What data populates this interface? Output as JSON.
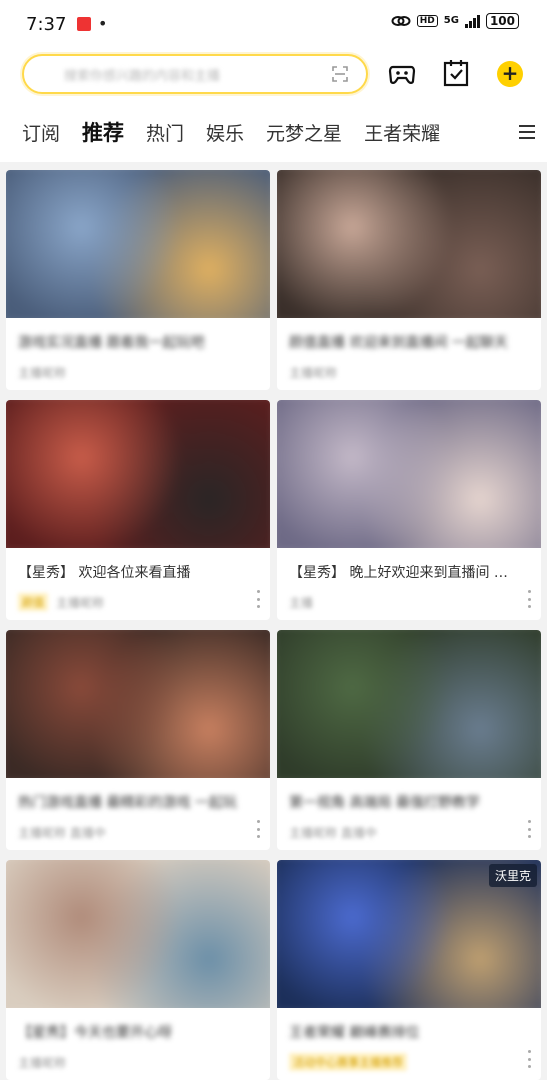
{
  "status_bar": {
    "time": "7:37",
    "dot": "•",
    "network": "5G",
    "hd": "HD",
    "battery": "100"
  },
  "search": {
    "placeholder": "搜索你感兴趣的内容和主播"
  },
  "tabs": [
    {
      "label": "订阅"
    },
    {
      "label": "推荐"
    },
    {
      "label": "热门"
    },
    {
      "label": "娱乐"
    },
    {
      "label": "元梦之星"
    },
    {
      "label": "王者荣耀"
    }
  ],
  "cards": [
    {
      "title": "游戏实况直播 跟着我一起玩吧",
      "tag": "",
      "sub": "主播昵称",
      "badge": "",
      "colors": [
        "#4a5d7a",
        "#8aa6c9",
        "#e0b060"
      ]
    },
    {
      "title": "颜值直播 欢迎来到直播间 一起聊天",
      "tag": "",
      "sub": "主播昵称",
      "badge": "",
      "colors": [
        "#3a2f2a",
        "#c9a898",
        "#7a5f55"
      ]
    },
    {
      "title": "【星秀】 欢迎各位来看直播",
      "tag": "颜值",
      "sub": "主播昵称",
      "badge": "",
      "colors": [
        "#5c1e1e",
        "#c95d4a",
        "#2a2626"
      ]
    },
    {
      "title": "【星秀】 晚上好欢迎来到直播间 …",
      "tag": "",
      "sub": "主播",
      "badge": "",
      "colors": [
        "#6e6a86",
        "#c4b9c8",
        "#e6d5cf"
      ]
    },
    {
      "title": "热门游戏直播 最精彩的游戏 一起玩",
      "tag": "",
      "sub": "主播昵称 直播中",
      "badge": "",
      "colors": [
        "#3b2a25",
        "#8a4a3a",
        "#c88060"
      ]
    },
    {
      "title": "第一视角 高端局 最强打野教学",
      "tag": "",
      "sub": "主播昵称 直播中",
      "badge": "",
      "colors": [
        "#2f3c2a",
        "#4f6a44",
        "#6a7d90"
      ]
    },
    {
      "title": "【星秀】今天也要开心呀",
      "tag": "",
      "sub": "主播昵称",
      "badge": "",
      "colors": [
        "#d9cdbf",
        "#b08b7a",
        "#6b8fa8"
      ]
    },
    {
      "title": "王者荣耀 巅峰赛排位",
      "tag": "活动中心赛事主播推荐",
      "sub": "",
      "badge": "沃里克",
      "colors": [
        "#1c2f5a",
        "#4c6bd0",
        "#c0a070"
      ]
    }
  ]
}
